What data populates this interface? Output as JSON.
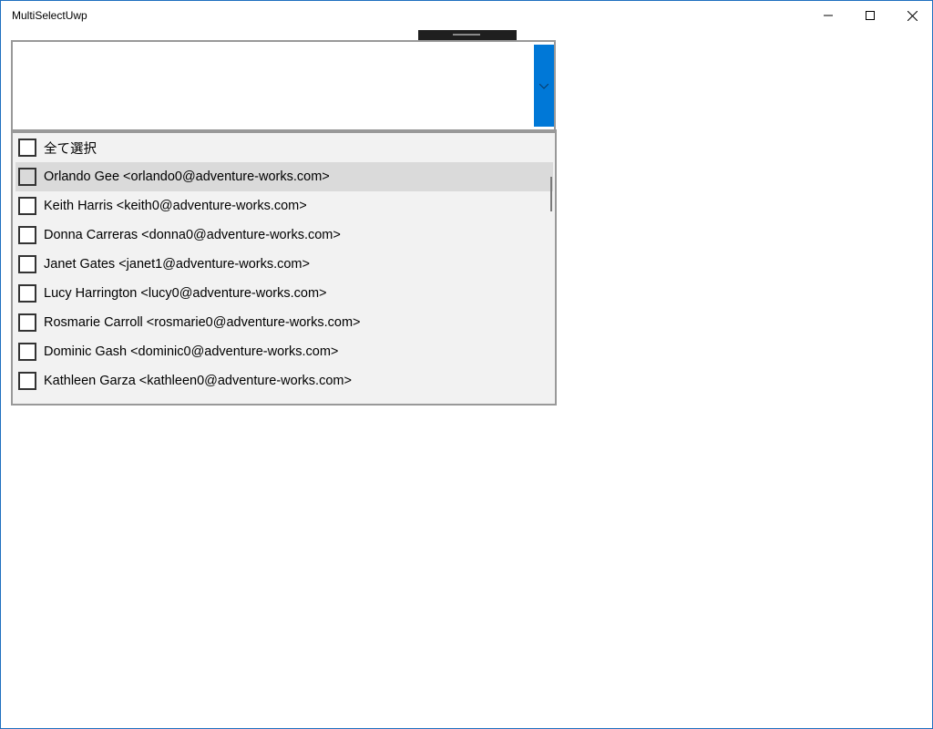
{
  "window": {
    "title": "MultiSelectUwp"
  },
  "icons": {
    "minimize": "minimize-icon",
    "maximize": "maximize-icon",
    "close": "close-icon",
    "dropdown": "chevron-down-icon"
  },
  "colors": {
    "accent": "#0078d7",
    "hover_row": "#dadada",
    "dropdown_bg": "#f2f2f2"
  },
  "combo": {
    "selected_text": ""
  },
  "list": {
    "select_all_label": "全て選択",
    "items": [
      {
        "label": "Orlando Gee <orlando0@adventure-works.com>",
        "checked": false,
        "hover": true
      },
      {
        "label": "Keith Harris <keith0@adventure-works.com>",
        "checked": false
      },
      {
        "label": "Donna Carreras <donna0@adventure-works.com>",
        "checked": false
      },
      {
        "label": "Janet Gates <janet1@adventure-works.com>",
        "checked": false
      },
      {
        "label": "Lucy Harrington <lucy0@adventure-works.com>",
        "checked": false
      },
      {
        "label": "Rosmarie Carroll <rosmarie0@adventure-works.com>",
        "checked": false
      },
      {
        "label": "Dominic Gash <dominic0@adventure-works.com>",
        "checked": false
      },
      {
        "label": "Kathleen Garza <kathleen0@adventure-works.com>",
        "checked": false
      }
    ]
  }
}
